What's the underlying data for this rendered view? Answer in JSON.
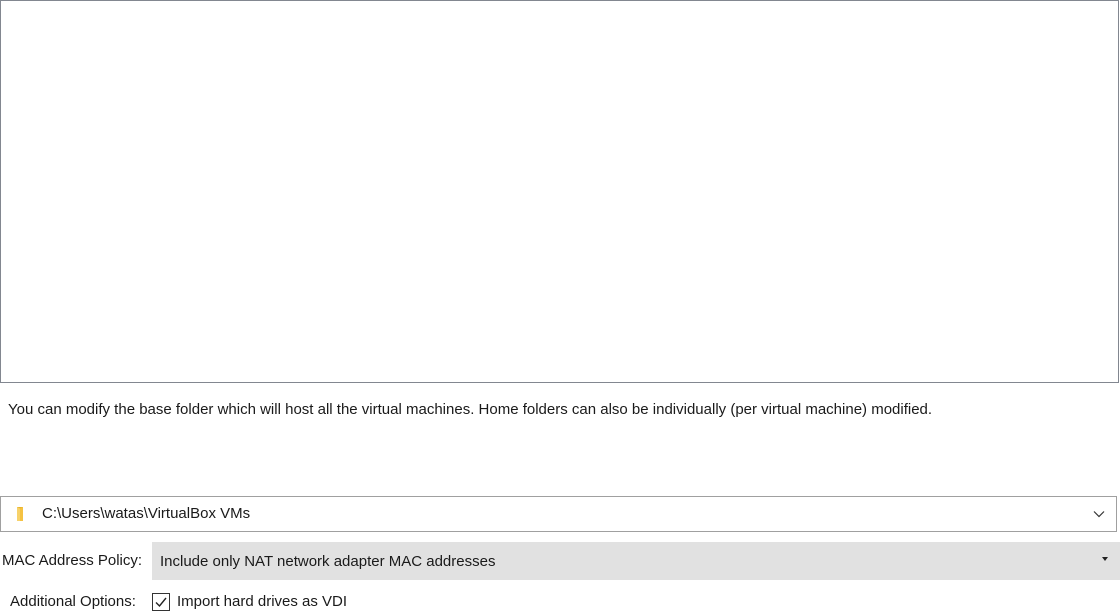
{
  "appliance_settings": {
    "rows": []
  },
  "base_folder": {
    "info_text": "You can modify the base folder which will host all the virtual machines. Home folders can also be individually (per virtual machine) modified.",
    "path": "C:\\Users\\watas\\VirtualBox VMs",
    "icon": "folder-icon"
  },
  "mac_policy": {
    "label": "MAC Address Policy:",
    "selected": "Include only NAT network adapter MAC addresses"
  },
  "additional_options": {
    "label": "Additional Options:",
    "import_vdi": {
      "label": "Import hard drives as VDI",
      "checked": true
    }
  },
  "colors": {
    "folder_yellow": "#f5c242",
    "combo_gray": "#e1e1e1",
    "border": "#828790"
  }
}
